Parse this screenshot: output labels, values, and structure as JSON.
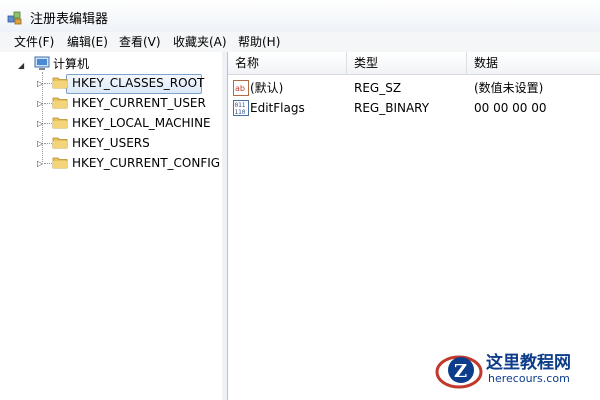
{
  "window": {
    "title": "注册表编辑器"
  },
  "menu": [
    {
      "label": "文件(F)"
    },
    {
      "label": "编辑(E)"
    },
    {
      "label": "查看(V)"
    },
    {
      "label": "收藏夹(A)"
    },
    {
      "label": "帮助(H)"
    }
  ],
  "tree": {
    "root": {
      "label": "计算机",
      "icon": "computer-icon"
    },
    "children": [
      {
        "label": "HKEY_CLASSES_ROOT",
        "selected": true
      },
      {
        "label": "HKEY_CURRENT_USER"
      },
      {
        "label": "HKEY_LOCAL_MACHINE"
      },
      {
        "label": "HKEY_USERS"
      },
      {
        "label": "HKEY_CURRENT_CONFIG"
      }
    ]
  },
  "list": {
    "columns": [
      "名称",
      "类型",
      "数据"
    ],
    "rows": [
      {
        "name": "(默认)",
        "type": "REG_SZ",
        "data": "(数值未设置)",
        "icon": "string-value-icon"
      },
      {
        "name": "EditFlags",
        "type": "REG_BINARY",
        "data": "00 00 00 00",
        "icon": "binary-value-icon"
      }
    ]
  },
  "watermark": {
    "title": "这里教程网",
    "url": "herecours.com"
  },
  "colors": {
    "folder": "#e8c15a",
    "selection_border": "#7da2ce",
    "watermark": "#0d3d8a"
  }
}
